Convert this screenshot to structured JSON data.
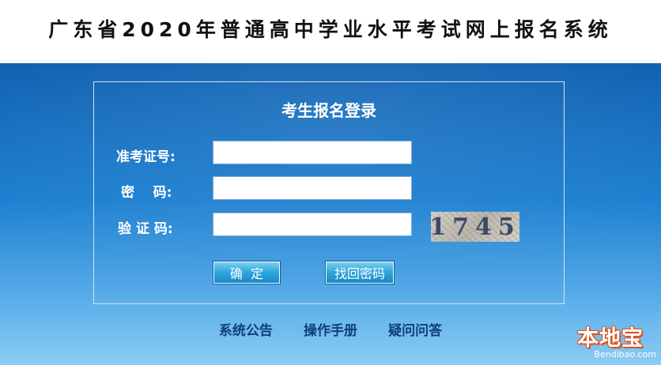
{
  "header": {
    "title": "广东省2020年普通高中学业水平考试网上报名系统"
  },
  "login": {
    "title": "考生报名登录",
    "fields": [
      {
        "label": "准考证号:",
        "value": "",
        "placeholder": ""
      },
      {
        "label": "密    码:",
        "value": "",
        "placeholder": ""
      },
      {
        "label": "验 证 码:",
        "value": "",
        "placeholder": ""
      }
    ],
    "captcha": "1745",
    "buttons": {
      "confirm": "确  定",
      "recover": "找回密码"
    }
  },
  "footer_links": [
    "系统公告",
    "操作手册",
    "疑问问答"
  ],
  "watermark": {
    "logo": "本地宝",
    "domain": "Bendibao.com"
  },
  "colors": {
    "header_bg": "#ffffff",
    "main_bg_top": "#0d5fb0",
    "main_bg_bottom": "#8cccf4",
    "link": "#0f3f7a",
    "button": "#2ea4db",
    "logo_orange": "#d9531e"
  }
}
